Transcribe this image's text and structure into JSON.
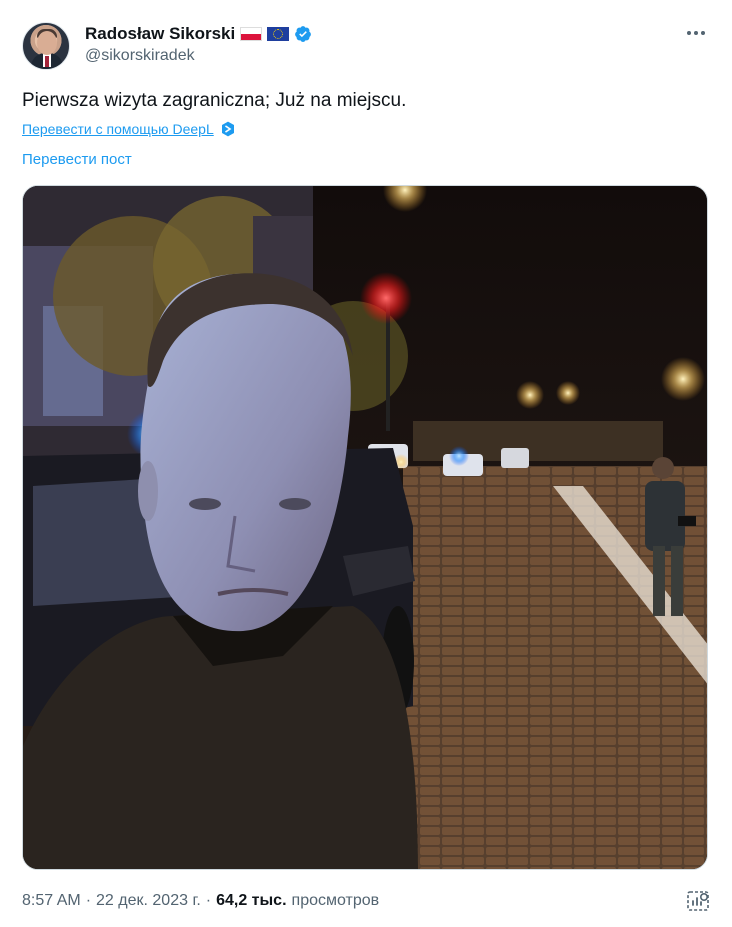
{
  "author": {
    "display_name": "Radosław Sikorski",
    "handle": "@sikorskiradek",
    "flags": [
      "flag-poland-icon",
      "flag-eu-icon"
    ],
    "verified_color": "#1d9bf0"
  },
  "tweet": {
    "text": "Pierwsza wizyta zagraniczna; Już na miejscu.",
    "deepl_link": "Перевести с помощью DeepL",
    "translate_post": "Перевести пост"
  },
  "meta": {
    "time": "8:57 AM",
    "separator1": "·",
    "date": "22 дек. 2023 г.",
    "separator2": "·",
    "views_count": "64,2 тыс.",
    "views_label": "просмотров"
  },
  "colors": {
    "link": "#1d9bf0",
    "secondary_text": "#536471",
    "primary_text": "#0f1419"
  }
}
